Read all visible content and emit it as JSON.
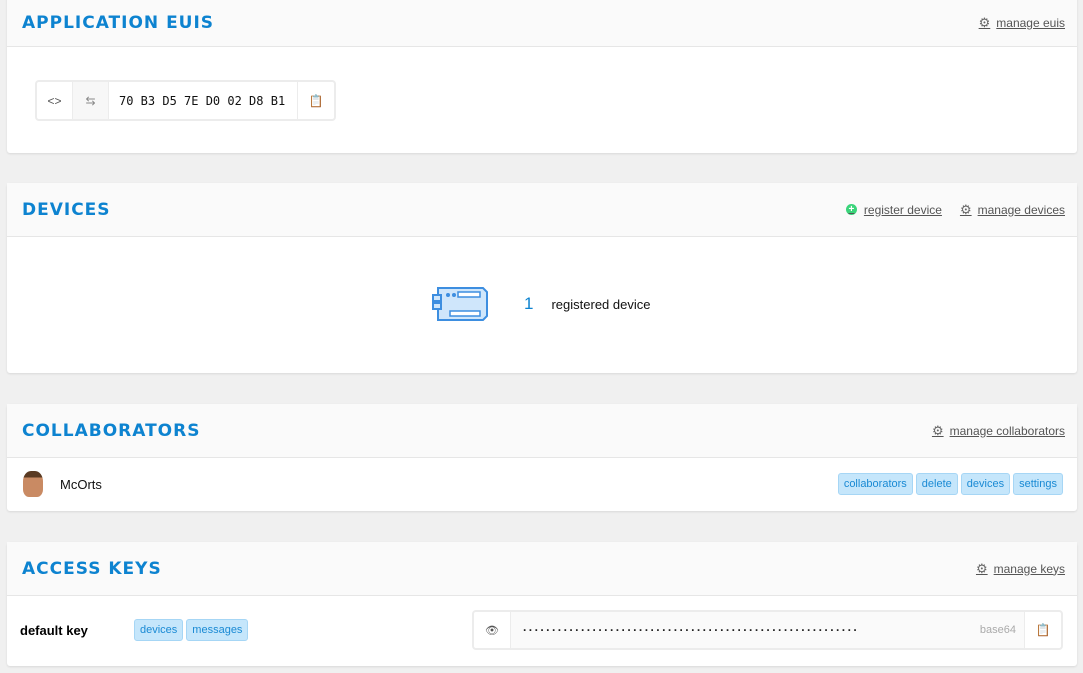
{
  "euis": {
    "title": "APPLICATION EUIS",
    "manage": "manage euis",
    "code_icon": "<>",
    "swap_icon": "⇆",
    "value": "70 B3 D5 7E D0 02 D8 B1"
  },
  "devices": {
    "title": "DEVICES",
    "register": "register device",
    "manage": "manage devices",
    "count": "1",
    "label": "registered device"
  },
  "collaborators": {
    "title": "COLLABORATORS",
    "manage": "manage collaborators",
    "items": [
      {
        "name": "McOrts",
        "rights": [
          "collaborators",
          "delete",
          "devices",
          "settings"
        ]
      }
    ]
  },
  "access_keys": {
    "title": "ACCESS KEYS",
    "manage": "manage keys",
    "items": [
      {
        "name": "default key",
        "rights": [
          "devices",
          "messages"
        ],
        "masked": "··························································",
        "format": "base64"
      }
    ]
  },
  "colors": {
    "accent": "#0d83d0",
    "tag_bg": "#c5e6fb"
  }
}
